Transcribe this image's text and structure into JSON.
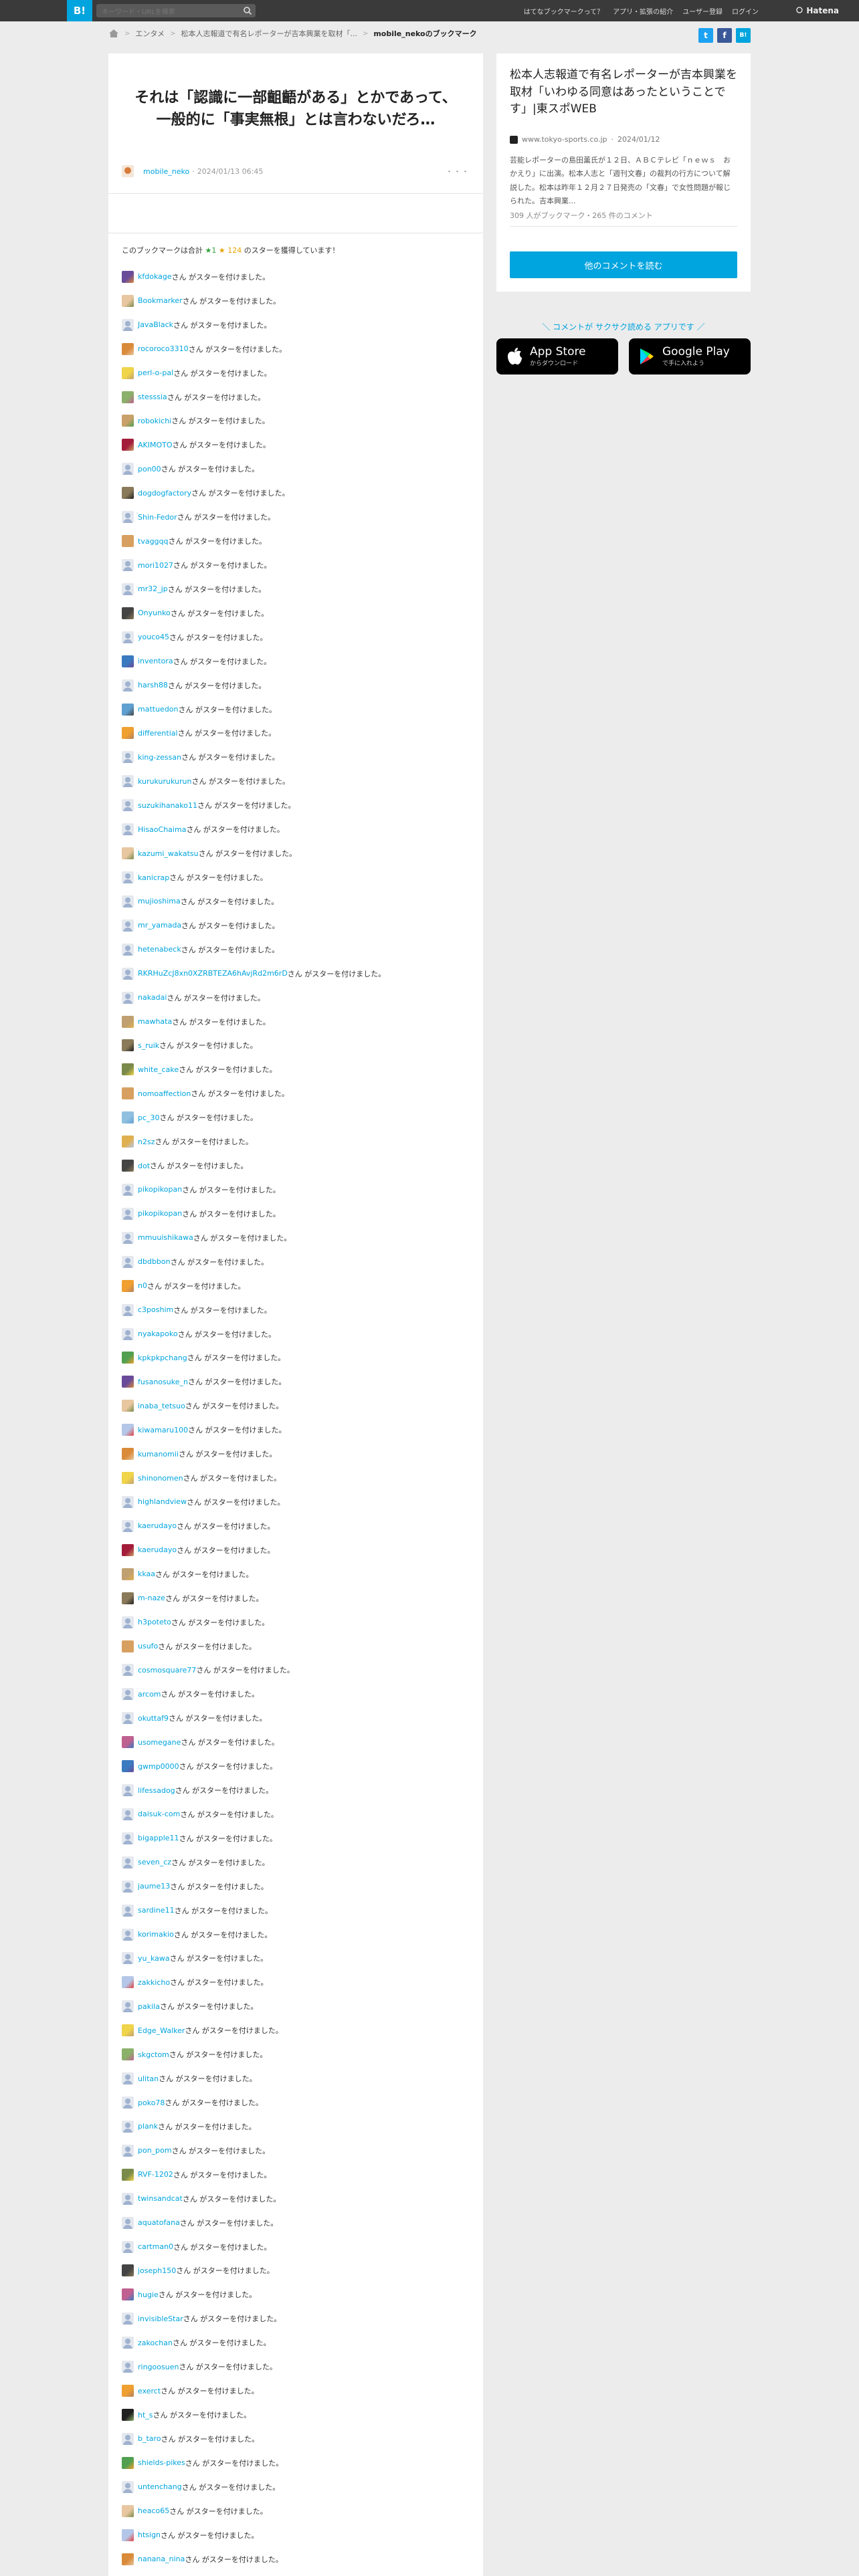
{
  "topbar": {
    "logo": "B!",
    "search_placeholder": "キーワード・URLを検索",
    "nav": [
      "はてなブックマークって？",
      "アプリ・拡張の紹介",
      "ユーザー登録",
      "ログイン"
    ],
    "brand": "Hatena"
  },
  "breadcrumb": [
    "エンタメ",
    "松本人志報道で有名レポーターが吉本興業を取材「...",
    "mobile_nekoのブックマーク"
  ],
  "share": [
    "Twitter",
    "Facebook",
    "B!"
  ],
  "main": {
    "title": "それは「認識に一部齟齬がある」とかであって、一般的に「事実無根」とは言わないだろ…",
    "user": "mobile_neko",
    "date": "2024/01/13 06:45",
    "menu": "・・・",
    "star_summary": {
      "prefix": "このブックマークは合計",
      "green": "★1",
      "yellow": "★ 124",
      "suffix": "のスターを獲得しています！"
    },
    "suffix": "さん がスターを付けました。",
    "stars": [
      "kfdokage",
      "Bookmarker",
      "JavaBlack",
      "rocoroco3310",
      "perl-o-pal",
      "stesssia",
      "robokichi",
      "AKIMOTO",
      "pon00",
      "dogdogfactory",
      "Shin-Fedor",
      "tvaggqq",
      "mori1027",
      "mr32_jp",
      "Onyunko",
      "youco45",
      "inventora",
      "harsh88",
      "mattuedon",
      "differential",
      "king-zessan",
      "kurukurukurun",
      "suzukihanako11",
      "HisaoChaima",
      "kazumi_wakatsu",
      "kanicrap",
      "mujioshima",
      "mr_yamada",
      "hetenabeck",
      "RKRHuZcJ8xn0XZRBTEZA6hAvjRd2m6rD",
      "nakadai",
      "mawhata",
      "s_ruik",
      "white_cake",
      "nomoaffection",
      "pc_30",
      "n2sz",
      "dot",
      "pikopikopan",
      "pikopikopan",
      "mmuuishikawa",
      "dbdbbon",
      "n0",
      "c3poshim",
      "nyakapoko",
      "kpkpkpchang",
      "fusanosuke_n",
      "inaba_tetsuo",
      "kiwamaru100",
      "kumanomii",
      "shinonomen",
      "highlandview",
      "kaerudayo",
      "kaerudayo",
      "kkaa",
      "m-naze",
      "h3poteto",
      "usufo",
      "cosmosquare77",
      "arcom",
      "okuttaf9",
      "usomegane",
      "gwmp0000",
      "lifessadog",
      "daisuk-com",
      "bigapple11",
      "seven_cz",
      "jaume13",
      "sardine11",
      "korimakio",
      "yu_kawa",
      "zakkicho",
      "pakila",
      "Edge_Walker",
      "skgctom",
      "ulitan",
      "poko78",
      "plank",
      "pon_pom",
      "RVF-1202",
      "twinsandcat",
      "aquatofana",
      "cartman0",
      "joseph150",
      "hugie",
      "invisibleStar",
      "zakochan",
      "ringoosuen",
      "exerct",
      "ht_s",
      "b_taro",
      "shields-pikes",
      "untenchang",
      "heaco65",
      "htsign",
      "nanana_nina"
    ]
  },
  "side": {
    "article_title": "松本人志報道で有名レポーターが吉本興業を取材「いわゆる同意はあったということです」|東スポWEB",
    "source": "www.tokyo-sports.co.jp",
    "date": "2024/01/12",
    "description": "芸能レポーターの島田薫氏が１２日、ＡＢＣテレビ「ｎｅｗｓ　おかえり」に出演。松本人志と「週刊文春」の裁判の行方について解説した。松本は昨年１２月２７日発売の「文春」で女性問題が報じられた。吉本興業...",
    "stats": "309 人がブックマーク・265 件のコメント",
    "button": "他のコメントを読む",
    "promo": "＼ コメントが サクサク読める アプリです ／",
    "appstore_small": "",
    "appstore_big": "App Store",
    "appstore_sub": "からダウンロード",
    "gplay_big": "Google Play",
    "gplay_sub": "で手に入れよう"
  },
  "colors": {
    "accent": "#00a4de",
    "topbar": "#3a3a3a",
    "background": "#ececec"
  }
}
